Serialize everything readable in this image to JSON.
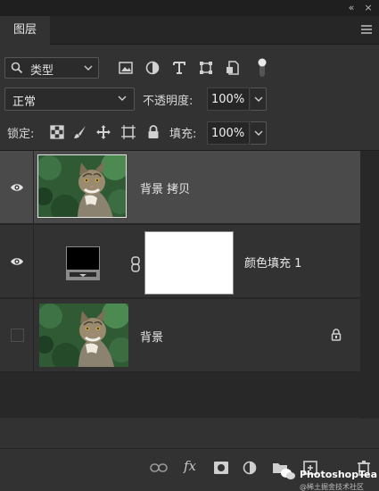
{
  "window": {
    "collapse_glyph": "«",
    "close_glyph": "×"
  },
  "panel_tab": "图层",
  "filter": {
    "kind_label": "类型",
    "icons": [
      "image-filter-icon",
      "adjustment-filter-icon",
      "type-filter-icon",
      "shape-filter-icon",
      "smart-object-filter-icon",
      "filter-toggle-icon"
    ]
  },
  "blend_mode": "正常",
  "opacity": {
    "label": "不透明度:",
    "value": "100%"
  },
  "lock": {
    "label": "锁定:",
    "icons": [
      "lock-transparent-icon",
      "lock-image-icon",
      "lock-position-icon",
      "lock-artboard-icon",
      "lock-all-icon"
    ]
  },
  "fill": {
    "label": "填充:",
    "value": "100%"
  },
  "layers": [
    {
      "name": "背景 拷贝",
      "visible": true,
      "selected": true,
      "type": "image"
    },
    {
      "name": "颜色填充 1",
      "visible": true,
      "selected": false,
      "type": "fill",
      "fill_color": "#000000",
      "mask_color": "#ffffff"
    },
    {
      "name": "背景",
      "visible": false,
      "selected": false,
      "type": "image",
      "locked": true
    }
  ],
  "bottom_toolbar": {
    "fx_label": "fx",
    "icons": [
      "link-layers-icon",
      "fx-icon",
      "add-mask-icon",
      "new-adjustment-icon",
      "new-group-icon",
      "new-layer-icon",
      "delete-layer-icon"
    ]
  },
  "watermark": {
    "title": "PhotoshopTea",
    "subtitle": "@稀土掘金技术社区"
  }
}
